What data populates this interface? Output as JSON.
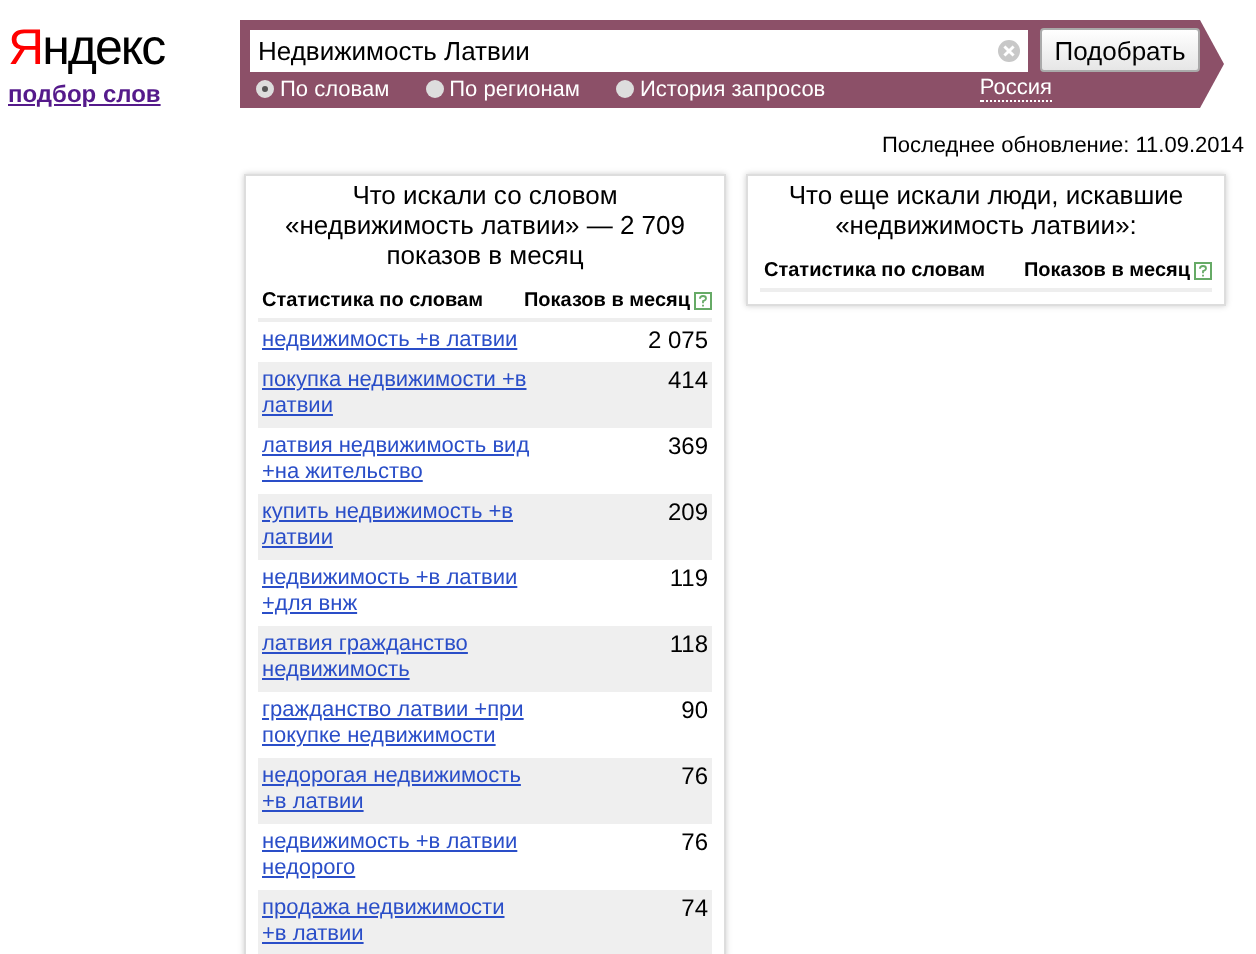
{
  "logo": {
    "text": "Яндекс",
    "subtitle": "подбор слов"
  },
  "search": {
    "value": "Недвижимость Латвии",
    "button": "Подобрать",
    "modes": [
      {
        "label": "По словам",
        "selected": true
      },
      {
        "label": "По регионам",
        "selected": false
      },
      {
        "label": "История запросов",
        "selected": false
      }
    ],
    "region": "Россия"
  },
  "last_update": "Последнее обновление: 11.09.2014",
  "left_panel": {
    "title": "Что искали со словом «недвижимость латвии» — 2 709 показов в месяц",
    "columns": [
      "Статистика по словам",
      "Показов в месяц"
    ],
    "rows": [
      {
        "phrase": "недвижимость +в латвии",
        "count": "2 075"
      },
      {
        "phrase": "покупка недвижимости +в латвии",
        "count": "414"
      },
      {
        "phrase": "латвия недвижимость вид +на жительство",
        "count": "369"
      },
      {
        "phrase": "купить недвижимость +в латвии",
        "count": "209"
      },
      {
        "phrase": "недвижимость +в латвии +для внж",
        "count": "119"
      },
      {
        "phrase": "латвия гражданство недвижимость",
        "count": "118"
      },
      {
        "phrase": "гражданство латвии +при покупке недвижимости",
        "count": "90"
      },
      {
        "phrase": "недорогая недвижимость +в латвии",
        "count": "76"
      },
      {
        "phrase": "недвижимость +в латвии недорого",
        "count": "76"
      },
      {
        "phrase": "продажа недвижимости +в латвии",
        "count": "74"
      }
    ]
  },
  "right_panel": {
    "title": "Что еще искали люди, искавшие «недвижимость латвии»:",
    "columns": [
      "Статистика по словам",
      "Показов в месяц"
    ]
  }
}
